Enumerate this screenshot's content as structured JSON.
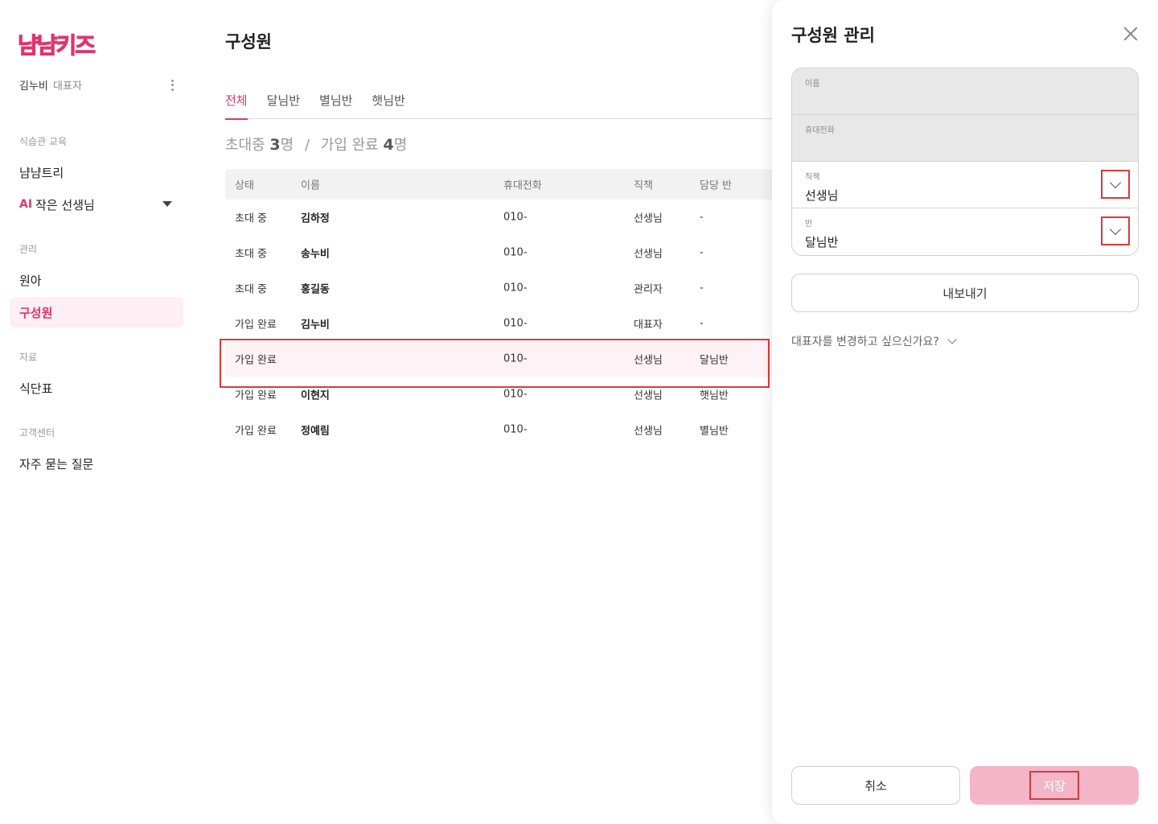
{
  "brand": {
    "logo_text": "냠냠키즈",
    "accent": "#e0356f"
  },
  "user": {
    "name": "김누비",
    "role": "대표자"
  },
  "sidebar": {
    "sections": [
      {
        "title": "식습관 교육"
      },
      {
        "title": "관리"
      },
      {
        "title": "자료"
      },
      {
        "title": "고객센터"
      }
    ],
    "items": {
      "nyam_tree": "냠냠트리",
      "ai_badge": "AI",
      "ai_teacher": "작은 선생님",
      "kids": "원아",
      "members": "구성원",
      "menu": "식단표",
      "faq": "자주 묻는 질문"
    }
  },
  "main": {
    "title": "구성원",
    "tabs": [
      "전체",
      "달님반",
      "별님반",
      "햇님반"
    ],
    "summary": {
      "invited_label": "초대중",
      "invited_count": "3",
      "unit": "명",
      "joined_label": "가입 완료",
      "joined_count": "4",
      "separator": "/"
    },
    "table": {
      "headers": [
        "상태",
        "이름",
        "휴대전화",
        "직책",
        "담당 반"
      ],
      "rows": [
        {
          "status": "초대 중",
          "name": "김하정",
          "phone": "010-",
          "position": "선생님",
          "class": "-"
        },
        {
          "status": "초대 중",
          "name": "송누비",
          "phone": "010-",
          "position": "선생님",
          "class": "-"
        },
        {
          "status": "초대 중",
          "name": "홍길동",
          "phone": "010-",
          "position": "관리자",
          "class": "-"
        },
        {
          "status": "가입 완료",
          "name": "김누비",
          "phone": "010-",
          "position": "대표자",
          "class": "-"
        },
        {
          "status": "가입 완료",
          "name": "",
          "phone": "010-",
          "position": "선생님",
          "class": "달님반"
        },
        {
          "status": "가입 완료",
          "name": "이현지",
          "phone": "010-",
          "position": "선생님",
          "class": "햇님반"
        },
        {
          "status": "가입 완료",
          "name": "정예림",
          "phone": "010-",
          "position": "선생님",
          "class": "별님반"
        }
      ]
    }
  },
  "drawer": {
    "title": "구성원 관리",
    "fields": {
      "name_label": "이름",
      "phone_label": "휴대전화",
      "position_label": "직책",
      "position_value": "선생님",
      "class_label": "반",
      "class_value": "달님반"
    },
    "export_label": "내보내기",
    "change_rep_label": "대표자를 변경하고 싶으신가요?",
    "cancel_label": "취소",
    "save_label": "저장"
  }
}
